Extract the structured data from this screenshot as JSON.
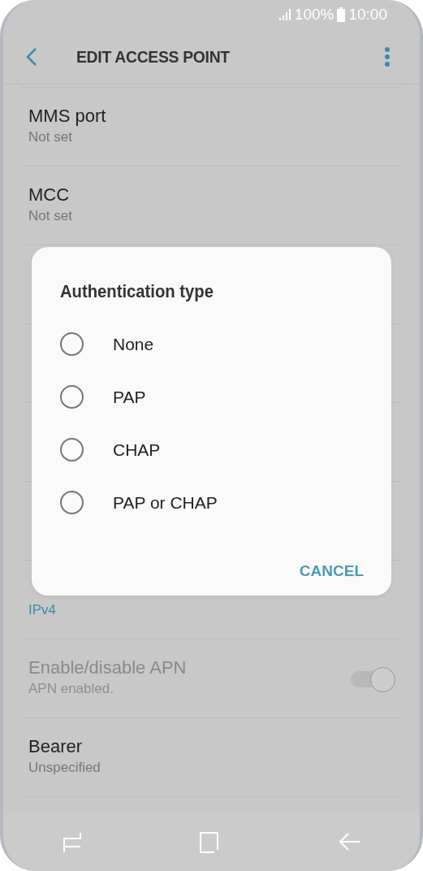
{
  "status_bar": {
    "battery": "100%",
    "time": "10:00"
  },
  "app_bar": {
    "title": "EDIT ACCESS POINT"
  },
  "rows": [
    {
      "kind": "plain",
      "title": "MMS port",
      "value": "Not set"
    },
    {
      "kind": "plain",
      "title": "MCC",
      "value": "Not set"
    },
    {
      "kind": "covered"
    },
    {
      "kind": "covered"
    },
    {
      "kind": "covered"
    },
    {
      "kind": "covered"
    },
    {
      "kind": "accent",
      "value": "IPv4"
    },
    {
      "kind": "toggle",
      "title": "Enable/disable APN",
      "value": "APN enabled.",
      "disabled": true,
      "on": true
    },
    {
      "kind": "plain",
      "title": "Bearer",
      "value": "Unspecified"
    }
  ],
  "dialog": {
    "title": "Authentication type",
    "options": [
      {
        "label": "None",
        "selected": false
      },
      {
        "label": "PAP",
        "selected": false
      },
      {
        "label": "CHAP",
        "selected": false
      },
      {
        "label": "PAP or CHAP",
        "selected": false
      }
    ],
    "buttons": [
      "CANCEL"
    ]
  }
}
